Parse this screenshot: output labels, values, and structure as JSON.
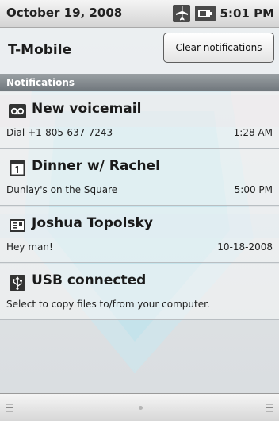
{
  "status_bar": {
    "date": "October 19, 2008",
    "time": "5:01 PM",
    "icons": [
      "airplane-mode-icon",
      "battery-icon"
    ]
  },
  "carrier": {
    "name": "T-Mobile",
    "clear_label": "Clear notifications"
  },
  "section": {
    "title": "Notifications"
  },
  "notifications": [
    {
      "icon": "voicemail-icon",
      "title": "New voicemail",
      "text": "Dial +1-805-637-7243",
      "time": "1:28 AM"
    },
    {
      "icon": "calendar-icon",
      "title": "Dinner w/ Rachel",
      "text": "Dunlay's on the Square",
      "time": "5:00 PM"
    },
    {
      "icon": "message-icon",
      "title": "Joshua Topolsky",
      "text": "Hey man!",
      "time": "10-18-2008"
    },
    {
      "icon": "usb-icon",
      "title": "USB connected",
      "text": "Select to copy files to/from your computer.",
      "time": ""
    }
  ],
  "colors": {
    "accent": "#25b5d6",
    "header": "#7a8186"
  }
}
